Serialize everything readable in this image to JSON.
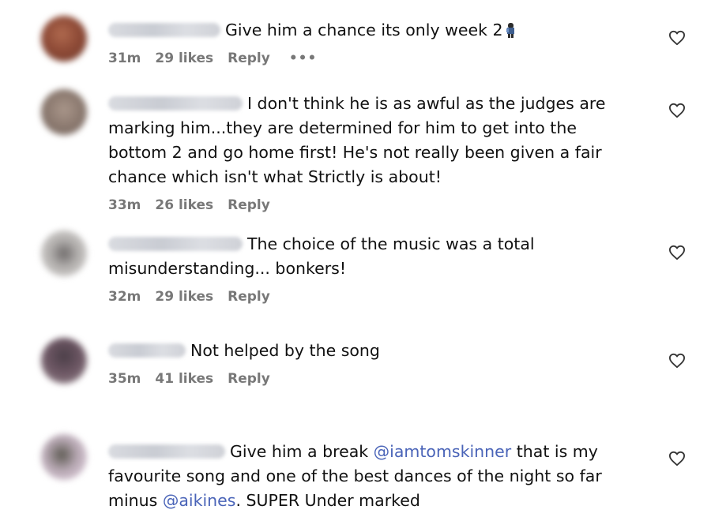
{
  "comments": [
    {
      "parts": {
        "before": "Give him a chance its only week 2"
      },
      "emoji_icon": "man-dancing-icon",
      "time": "31m",
      "likes": "29 likes",
      "reply": "Reply",
      "more": "•••"
    },
    {
      "parts": {
        "before": "I don't think he is as awful as the judges are marking him...they are determined for him to get into the bottom 2 and go home first! He's not really been given a fair chance which isn't what Strictly is about!"
      },
      "time": "33m",
      "likes": "26 likes",
      "reply": "Reply"
    },
    {
      "parts": {
        "before": "The choice of the music was a total misunderstanding... bonkers!"
      },
      "time": "32m",
      "likes": "29 likes",
      "reply": "Reply"
    },
    {
      "parts": {
        "before": "Not helped by the song"
      },
      "time": "35m",
      "likes": "41 likes",
      "reply": "Reply"
    },
    {
      "parts": {
        "before": "Give him a break ",
        "mention1": "@iamtomskinner",
        "middle": " that is my favourite song and one of the best dances of the night so far minus ",
        "mention2": "@aikines",
        "after": ". SUPER Under marked"
      }
    }
  ],
  "colors": {
    "mention": "#4a64b8",
    "meta": "#787878",
    "text": "#111111"
  },
  "icons": {
    "like": "heart-outline-icon"
  }
}
